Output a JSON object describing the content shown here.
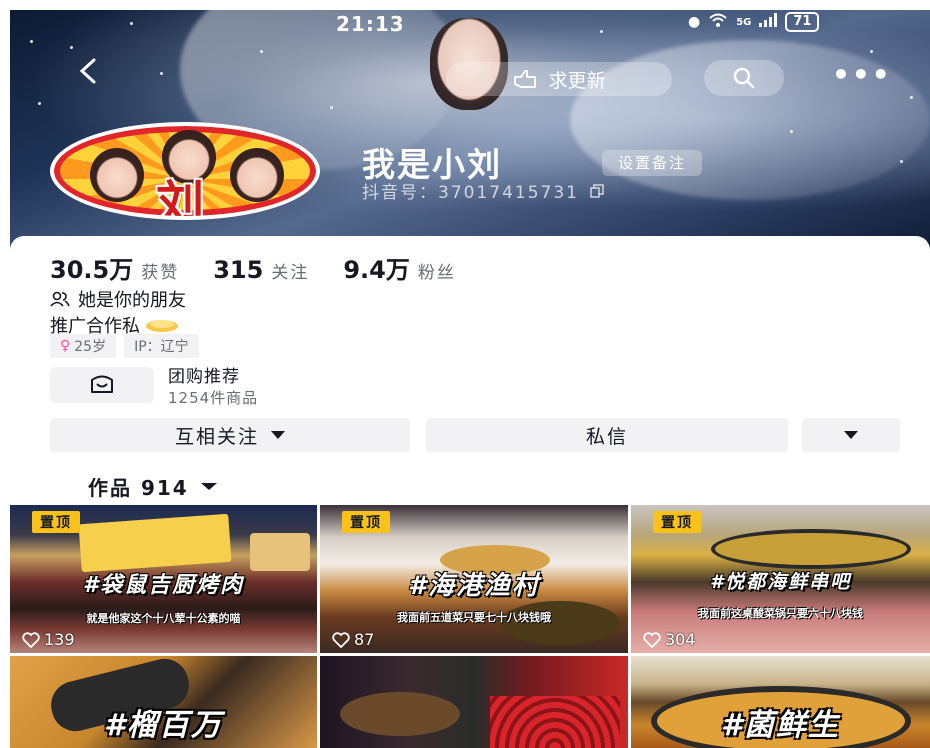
{
  "status_bar": {
    "time": "21:13",
    "network": "5G",
    "battery": "71"
  },
  "header": {
    "update_label": "求更新",
    "nickname": "我是小刘",
    "remark_label": "设置备注",
    "douyin_id": "抖音号：37017415731",
    "avatar_text": "刘"
  },
  "stats": [
    {
      "value": "30.5万",
      "label": "获赞"
    },
    {
      "value": "315",
      "label": "关注"
    },
    {
      "value": "9.4万",
      "label": "粉丝"
    }
  ],
  "bio": {
    "friend_note": "她是你的朋友",
    "text": "推广合作私",
    "tags": {
      "age": "25岁",
      "ip": "IP：辽宁"
    }
  },
  "group_buy": {
    "title": "团购推荐",
    "subtitle": "1254件商品"
  },
  "actions": {
    "follow_label": "互相关注",
    "message_label": "私信"
  },
  "works_tab": {
    "label": "作品 914"
  },
  "videos": [
    {
      "pinned": "置顶",
      "title": "#袋鼠吉厨烤肉",
      "subtitle": "就是他家这个十八荤十公素的喵",
      "likes": "139"
    },
    {
      "pinned": "置顶",
      "title": "#海港渔村",
      "subtitle": "我面前五道菜只要七十八块钱哦",
      "likes": "87"
    },
    {
      "pinned": "置顶",
      "title": "#悦都海鲜串吧",
      "subtitle": "我面前这桌酸菜锅只要六十八块钱",
      "likes": "304"
    },
    {
      "title": "#榴百万"
    },
    {
      "title": ""
    },
    {
      "title": "#菌鲜生"
    }
  ],
  "colors": {
    "pin": "#f8c21a",
    "accent_red": "#e0262a",
    "text_primary": "#161823",
    "text_secondary": "#6b6d75",
    "button_bg": "#f2f2f4"
  }
}
